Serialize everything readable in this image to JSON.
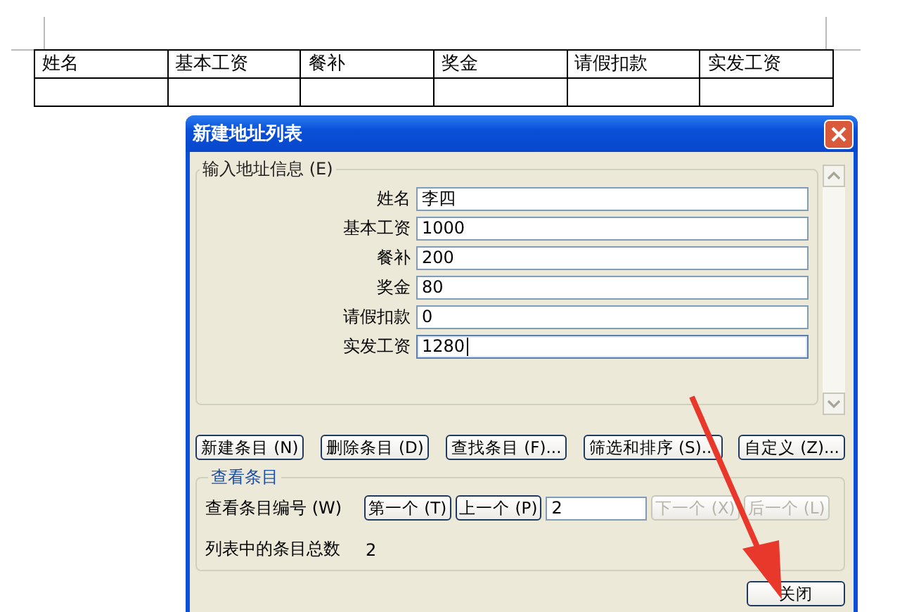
{
  "document": {
    "table": {
      "columns": [
        "姓名",
        "基本工资",
        "餐补",
        "奖金",
        "请假扣款",
        "实发工资"
      ],
      "rows": [
        [
          "",
          "",
          "",
          "",
          "",
          ""
        ]
      ]
    }
  },
  "dialog": {
    "title": "新建地址列表",
    "entry_group": {
      "title": "输入地址信息 (E)",
      "fields": [
        {
          "label": "姓名",
          "value": "李四",
          "focused": false
        },
        {
          "label": "基本工资",
          "value": "1000",
          "focused": false
        },
        {
          "label": "餐补",
          "value": "200",
          "focused": false
        },
        {
          "label": "奖金",
          "value": "80",
          "focused": false
        },
        {
          "label": "请假扣款",
          "value": "0",
          "focused": false
        },
        {
          "label": "实发工资",
          "value": "1280",
          "focused": true
        }
      ]
    },
    "buttons": [
      {
        "label": "新建条目 (N)"
      },
      {
        "label": "删除条目 (D)"
      },
      {
        "label": "查找条目 (F)..."
      },
      {
        "label": "筛选和排序 (S)..."
      },
      {
        "label": "自定义 (Z)..."
      }
    ],
    "view_group": {
      "title": "查看条目",
      "number_label": "查看条目编号 (W)",
      "nav_before": [
        {
          "label": "第一个 (T)",
          "disabled": false
        },
        {
          "label": "上一个 (P)",
          "disabled": false
        }
      ],
      "nav_after": [
        {
          "label": "下一个 (X)",
          "disabled": true
        },
        {
          "label": "后一个 (L)",
          "disabled": true
        }
      ],
      "number_value": "2",
      "count_label": "列表中的条目总数",
      "count_value": "2"
    },
    "close_button": "关闭"
  }
}
